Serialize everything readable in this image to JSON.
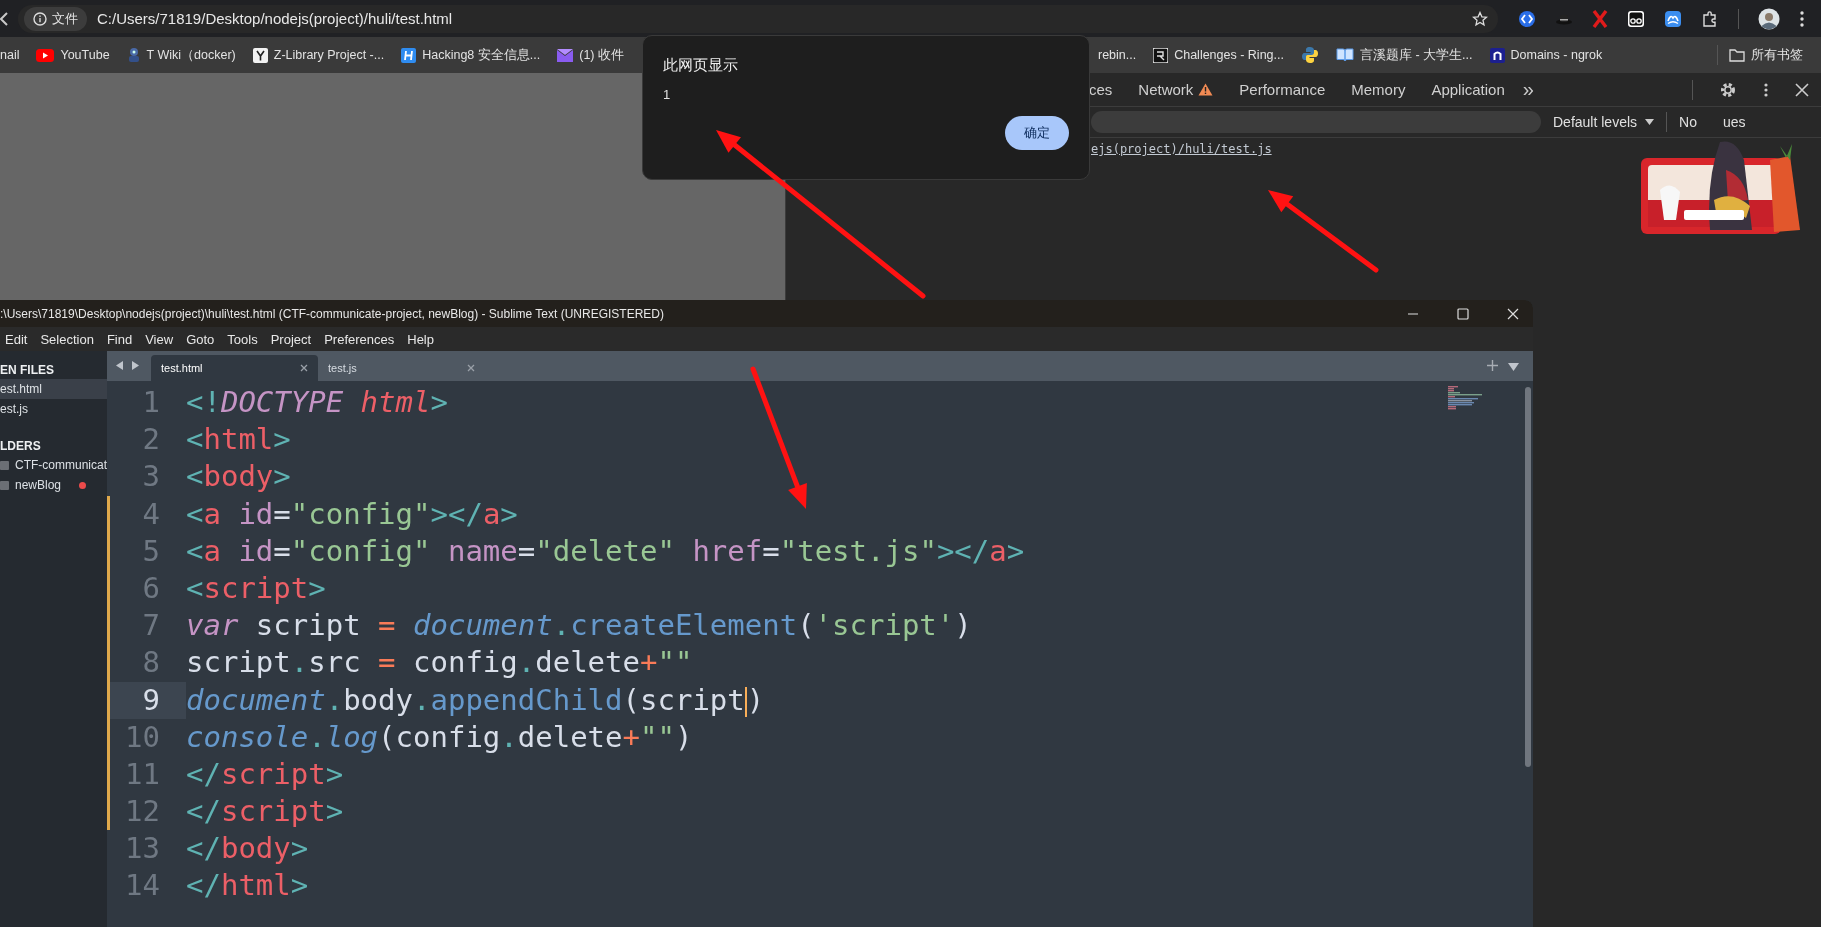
{
  "browser": {
    "address": {
      "security_label": "文件",
      "url": "C:/Users/71819/Desktop/nodejs(project)/huli/test.html"
    },
    "bookmarks": [
      {
        "label": "nail"
      },
      {
        "label": "YouTube"
      },
      {
        "label": "T Wiki（docker)"
      },
      {
        "label": "Z-Library Project -..."
      },
      {
        "label": "Hacking8 安全信息..."
      },
      {
        "label": "(1) 收件"
      },
      {
        "label": "rebin..."
      },
      {
        "label": "Challenges - Ring..."
      },
      {
        "kind": "icon_only"
      },
      {
        "label": "言溪题库 - 大学生..."
      },
      {
        "label": "Domains - ngrok"
      }
    ],
    "all_bookmarks": "所有书签"
  },
  "devtools": {
    "tabs": [
      {
        "label": "ces",
        "selected": false,
        "warning": false
      },
      {
        "label": "Network",
        "selected": false,
        "warning": true
      },
      {
        "label": "Performance",
        "selected": false,
        "warning": false
      },
      {
        "label": "Memory",
        "selected": false,
        "warning": false
      },
      {
        "label": "Application",
        "selected": false,
        "warning": false
      }
    ],
    "more_tabs": "»",
    "levels": "Default levels",
    "issues": [
      "No",
      "ues"
    ],
    "console_link": "ejs(project)/huli/test.js"
  },
  "dialog": {
    "title": "此网页显示",
    "message": "1",
    "button": "确定"
  },
  "sublime": {
    "title": ":\\Users\\71819\\Desktop\\nodejs(project)\\huli\\test.html (CTF-communicate-project, newBlog) - Sublime Text (UNREGISTERED)",
    "menu": [
      "Edit",
      "Selection",
      "Find",
      "View",
      "Goto",
      "Tools",
      "Project",
      "Preferences",
      "Help"
    ],
    "sidebar": {
      "open_files_header": "EN FILES",
      "open_files": [
        {
          "name": "est.html",
          "selected": true
        },
        {
          "name": "est.js",
          "selected": false
        }
      ],
      "folders_header": "LDERS",
      "folders": [
        {
          "name": "CTF-communicat",
          "modified": false
        },
        {
          "name": "newBlog",
          "modified": true
        }
      ]
    },
    "tabs": [
      {
        "label": "test.html",
        "selected": true
      },
      {
        "label": "test.js",
        "selected": false
      }
    ],
    "lines": [
      {
        "number": "1",
        "modified": false,
        "current": false,
        "tokens": [
          {
            "text": "<!",
            "kind": "punct"
          },
          {
            "text": "DOCTYPE",
            "kind": "doctype"
          },
          {
            "text": " html",
            "kind": "doctype_name"
          },
          {
            "text": ">",
            "kind": "punct"
          }
        ]
      },
      {
        "number": "2",
        "modified": false,
        "current": false,
        "tokens": [
          {
            "text": "<",
            "kind": "punct"
          },
          {
            "text": "html",
            "kind": "tag"
          },
          {
            "text": ">",
            "kind": "punct"
          }
        ]
      },
      {
        "number": "3",
        "modified": false,
        "current": false,
        "tokens": [
          {
            "text": "<",
            "kind": "punct"
          },
          {
            "text": "body",
            "kind": "tag"
          },
          {
            "text": ">",
            "kind": "punct"
          }
        ]
      },
      {
        "number": "4",
        "modified": true,
        "current": false,
        "tokens": [
          {
            "text": "<",
            "kind": "punct"
          },
          {
            "text": "a",
            "kind": "tag"
          },
          {
            "text": " id",
            "kind": "attr"
          },
          {
            "text": "=",
            "kind": "plain"
          },
          {
            "text": "\"config\"",
            "kind": "string"
          },
          {
            "text": "></",
            "kind": "punct"
          },
          {
            "text": "a",
            "kind": "tag"
          },
          {
            "text": ">",
            "kind": "punct"
          }
        ]
      },
      {
        "number": "5",
        "modified": true,
        "current": false,
        "tokens": [
          {
            "text": "<",
            "kind": "punct"
          },
          {
            "text": "a",
            "kind": "tag"
          },
          {
            "text": " id",
            "kind": "attr"
          },
          {
            "text": "=",
            "kind": "plain"
          },
          {
            "text": "\"config\"",
            "kind": "string"
          },
          {
            "text": " name",
            "kind": "attr"
          },
          {
            "text": "=",
            "kind": "plain"
          },
          {
            "text": "\"delete\"",
            "kind": "string"
          },
          {
            "text": " href",
            "kind": "attr"
          },
          {
            "text": "=",
            "kind": "plain"
          },
          {
            "text": "\"test.js\"",
            "kind": "string"
          },
          {
            "text": "></",
            "kind": "punct"
          },
          {
            "text": "a",
            "kind": "tag"
          },
          {
            "text": ">",
            "kind": "punct"
          }
        ]
      },
      {
        "number": "6",
        "modified": true,
        "current": false,
        "tokens": [
          {
            "text": "<",
            "kind": "punct"
          },
          {
            "text": "script",
            "kind": "tag"
          },
          {
            "text": ">",
            "kind": "punct"
          }
        ]
      },
      {
        "number": "7",
        "modified": true,
        "current": false,
        "tokens": [
          {
            "text": "var",
            "kind": "keyword"
          },
          {
            "text": " script ",
            "kind": "plain"
          },
          {
            "text": "=",
            "kind": "op"
          },
          {
            "text": " document",
            "kind": "object"
          },
          {
            "text": ".",
            "kind": "punct"
          },
          {
            "text": "createElement",
            "kind": "func"
          },
          {
            "text": "(",
            "kind": "plain"
          },
          {
            "text": "'script'",
            "kind": "string"
          },
          {
            "text": ")",
            "kind": "plain"
          }
        ]
      },
      {
        "number": "8",
        "modified": true,
        "current": false,
        "tokens": [
          {
            "text": "script",
            "kind": "plain"
          },
          {
            "text": ".",
            "kind": "punct"
          },
          {
            "text": "src ",
            "kind": "plain"
          },
          {
            "text": "=",
            "kind": "op"
          },
          {
            "text": " config",
            "kind": "plain"
          },
          {
            "text": ".",
            "kind": "punct"
          },
          {
            "text": "delete",
            "kind": "plain"
          },
          {
            "text": "+",
            "kind": "op"
          },
          {
            "text": "\"\"",
            "kind": "string"
          }
        ]
      },
      {
        "number": "9",
        "modified": true,
        "current": true,
        "tokens": [
          {
            "text": "document",
            "kind": "object"
          },
          {
            "text": ".",
            "kind": "punct"
          },
          {
            "text": "body",
            "kind": "plain"
          },
          {
            "text": ".",
            "kind": "punct"
          },
          {
            "text": "appendChild",
            "kind": "func"
          },
          {
            "text": "(",
            "kind": "plain"
          },
          {
            "text": "script",
            "kind": "plain",
            "cursor": true
          },
          {
            "text": ")",
            "kind": "plain"
          }
        ]
      },
      {
        "number": "10",
        "modified": true,
        "current": false,
        "tokens": [
          {
            "text": "console",
            "kind": "object"
          },
          {
            "text": ".",
            "kind": "punct"
          },
          {
            "text": "log",
            "kind": "support"
          },
          {
            "text": "(",
            "kind": "plain"
          },
          {
            "text": "config",
            "kind": "plain"
          },
          {
            "text": ".",
            "kind": "punct"
          },
          {
            "text": "delete",
            "kind": "plain"
          },
          {
            "text": "+",
            "kind": "op"
          },
          {
            "text": "\"\"",
            "kind": "string"
          },
          {
            "text": ")",
            "kind": "plain"
          }
        ]
      },
      {
        "number": "11",
        "modified": true,
        "current": false,
        "tokens": [
          {
            "text": "</",
            "kind": "punct"
          },
          {
            "text": "script",
            "kind": "tag"
          },
          {
            "text": ">",
            "kind": "punct"
          }
        ]
      },
      {
        "number": "12",
        "modified": true,
        "current": false,
        "tokens": [
          {
            "text": "</",
            "kind": "punct"
          },
          {
            "text": "script",
            "kind": "tag"
          },
          {
            "text": ">",
            "kind": "punct"
          }
        ]
      },
      {
        "number": "13",
        "modified": false,
        "current": false,
        "tokens": [
          {
            "text": "</",
            "kind": "punct"
          },
          {
            "text": "body",
            "kind": "tag"
          },
          {
            "text": ">",
            "kind": "punct"
          }
        ]
      },
      {
        "number": "14",
        "modified": false,
        "current": false,
        "tokens": [
          {
            "text": "</",
            "kind": "punct"
          },
          {
            "text": "html",
            "kind": "tag"
          },
          {
            "text": ">",
            "kind": "punct"
          }
        ]
      }
    ]
  }
}
